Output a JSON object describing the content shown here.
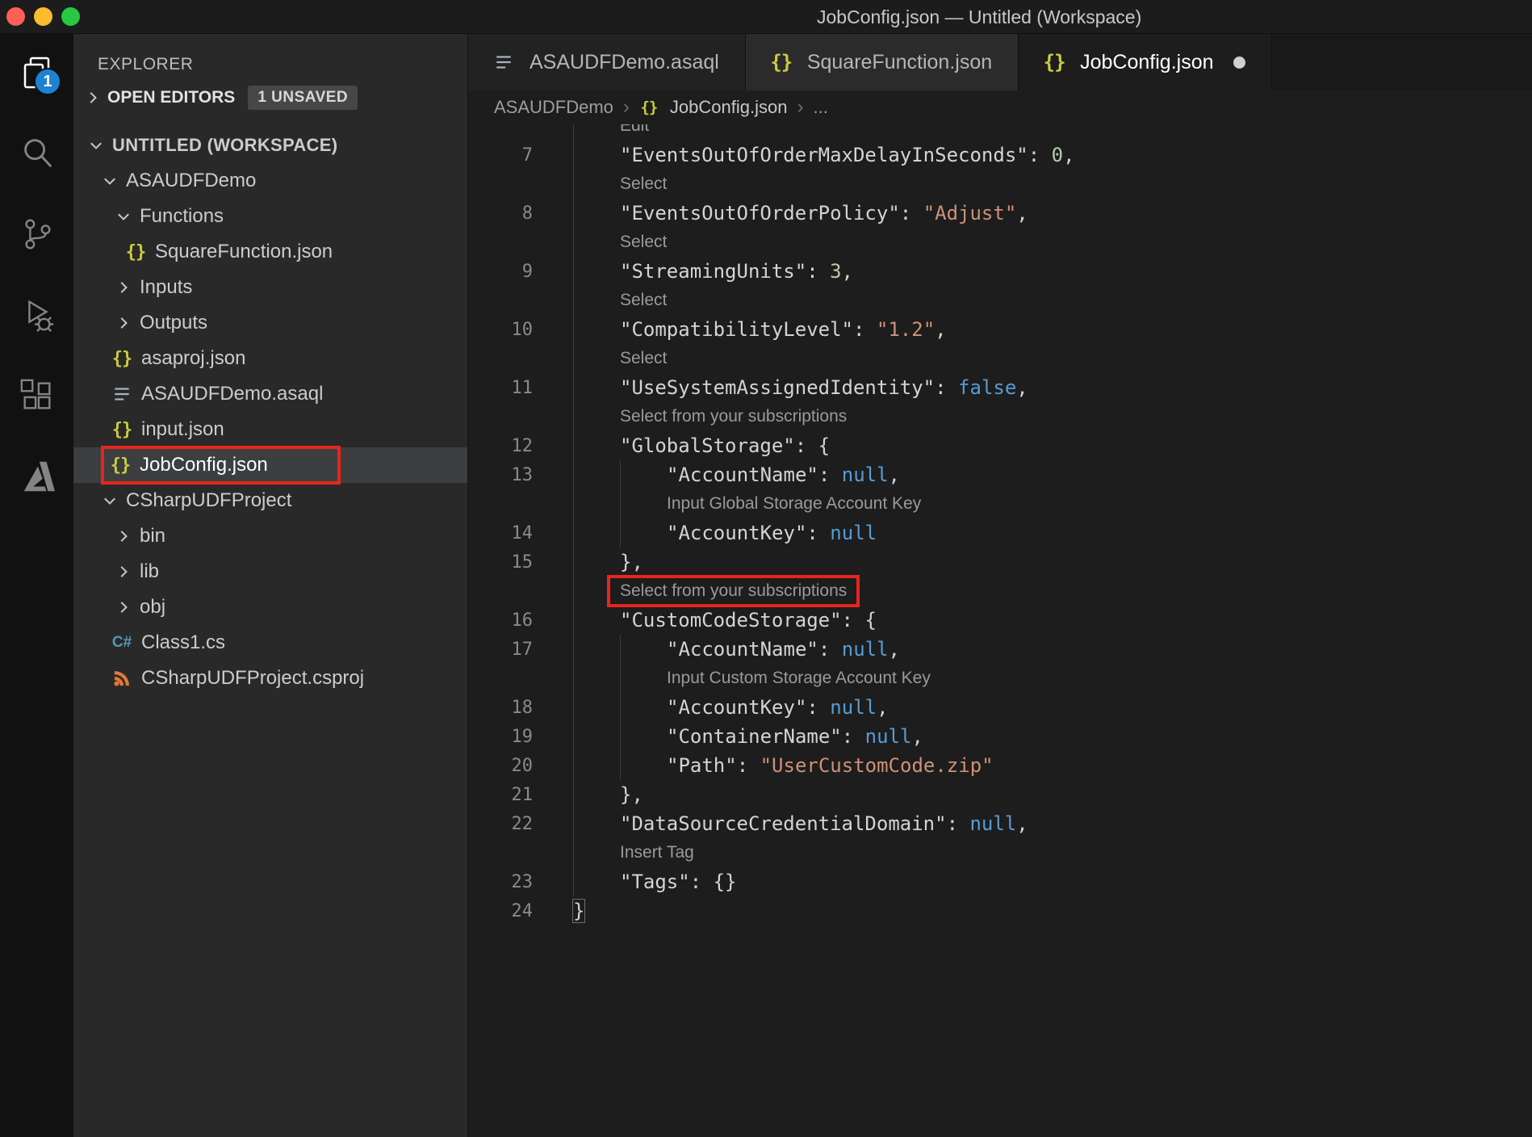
{
  "window": {
    "title": "JobConfig.json — Untitled (Workspace)"
  },
  "activity_bar": {
    "badge": "1",
    "items": [
      {
        "name": "explorer",
        "active": true
      },
      {
        "name": "search",
        "active": false
      },
      {
        "name": "source-control",
        "active": false
      },
      {
        "name": "run-debug",
        "active": false
      },
      {
        "name": "extensions",
        "active": false
      },
      {
        "name": "azure",
        "active": false
      }
    ]
  },
  "sidebar": {
    "header": "EXPLORER",
    "open_editors_label": "OPEN EDITORS",
    "unsaved_badge": "1 UNSAVED",
    "tree": [
      {
        "label": "UNTITLED (WORKSPACE)",
        "indent": 0,
        "root": true,
        "chevron": "expanded"
      },
      {
        "label": "ASAUDFDemo",
        "indent": 1,
        "chevron": "expanded"
      },
      {
        "label": "Functions",
        "indent": 2,
        "chevron": "expanded"
      },
      {
        "label": "SquareFunction.json",
        "indent": 3,
        "icon": "json"
      },
      {
        "label": "Inputs",
        "indent": 2,
        "chevron": "collapsed"
      },
      {
        "label": "Outputs",
        "indent": 2,
        "chevron": "collapsed"
      },
      {
        "label": "asaproj.json",
        "indent": 2,
        "icon": "json"
      },
      {
        "label": "ASAUDFDemo.asaql",
        "indent": 2,
        "icon": "asaql"
      },
      {
        "label": "input.json",
        "indent": 2,
        "icon": "json"
      },
      {
        "label": "JobConfig.json",
        "indent": 2,
        "icon": "json",
        "selected": true,
        "red_box": true
      },
      {
        "label": "CSharpUDFProject",
        "indent": 1,
        "chevron": "expanded"
      },
      {
        "label": "bin",
        "indent": 2,
        "chevron": "collapsed"
      },
      {
        "label": "lib",
        "indent": 2,
        "chevron": "collapsed"
      },
      {
        "label": "obj",
        "indent": 2,
        "chevron": "collapsed"
      },
      {
        "label": "Class1.cs",
        "indent": 2,
        "icon": "csharp"
      },
      {
        "label": "CSharpUDFProject.csproj",
        "indent": 2,
        "icon": "csproj"
      }
    ]
  },
  "tabs": [
    {
      "label": "ASAUDFDemo.asaql",
      "icon": "asaql",
      "active": false,
      "modified": false
    },
    {
      "label": "SquareFunction.json",
      "icon": "json",
      "active": false,
      "modified": false
    },
    {
      "label": "JobConfig.json",
      "icon": "json",
      "active": true,
      "modified": true
    }
  ],
  "breadcrumb": {
    "items": [
      {
        "label": "ASAUDFDemo"
      },
      {
        "label": "JobConfig.json",
        "icon": "json",
        "file": true
      },
      {
        "label": "..."
      }
    ]
  },
  "editor": {
    "rows": [
      {
        "kind": "lens",
        "indent": 1,
        "text": "Edit"
      },
      {
        "kind": "code",
        "ln": "7",
        "indent": 1,
        "tokens": [
          [
            "key",
            "\"EventsOutOfOrderMaxDelayInSeconds\""
          ],
          [
            "pun",
            ": "
          ],
          [
            "num",
            "0"
          ],
          [
            "pun",
            ","
          ]
        ]
      },
      {
        "kind": "lens",
        "indent": 1,
        "text": "Select"
      },
      {
        "kind": "code",
        "ln": "8",
        "indent": 1,
        "tokens": [
          [
            "key",
            "\"EventsOutOfOrderPolicy\""
          ],
          [
            "pun",
            ": "
          ],
          [
            "str",
            "\"Adjust\""
          ],
          [
            "pun",
            ","
          ]
        ]
      },
      {
        "kind": "lens",
        "indent": 1,
        "text": "Select"
      },
      {
        "kind": "code",
        "ln": "9",
        "indent": 1,
        "tokens": [
          [
            "key",
            "\"StreamingUnits\""
          ],
          [
            "pun",
            ": "
          ],
          [
            "num",
            "3"
          ],
          [
            "pun",
            ","
          ]
        ]
      },
      {
        "kind": "lens",
        "indent": 1,
        "text": "Select"
      },
      {
        "kind": "code",
        "ln": "10",
        "indent": 1,
        "tokens": [
          [
            "key",
            "\"CompatibilityLevel\""
          ],
          [
            "pun",
            ": "
          ],
          [
            "str",
            "\"1.2\""
          ],
          [
            "pun",
            ","
          ]
        ]
      },
      {
        "kind": "lens",
        "indent": 1,
        "text": "Select"
      },
      {
        "kind": "code",
        "ln": "11",
        "indent": 1,
        "tokens": [
          [
            "key",
            "\"UseSystemAssignedIdentity\""
          ],
          [
            "pun",
            ": "
          ],
          [
            "con",
            "false"
          ],
          [
            "pun",
            ","
          ]
        ]
      },
      {
        "kind": "lens",
        "indent": 1,
        "text": "Select from your subscriptions"
      },
      {
        "kind": "code",
        "ln": "12",
        "indent": 1,
        "tokens": [
          [
            "key",
            "\"GlobalStorage\""
          ],
          [
            "pun",
            ": {"
          ]
        ]
      },
      {
        "kind": "code",
        "ln": "13",
        "indent": 2,
        "tokens": [
          [
            "key",
            "\"AccountName\""
          ],
          [
            "pun",
            ": "
          ],
          [
            "con",
            "null"
          ],
          [
            "pun",
            ","
          ]
        ]
      },
      {
        "kind": "lens",
        "indent": 2,
        "text": "Input Global Storage Account Key"
      },
      {
        "kind": "code",
        "ln": "14",
        "indent": 2,
        "tokens": [
          [
            "key",
            "\"AccountKey\""
          ],
          [
            "pun",
            ": "
          ],
          [
            "con",
            "null"
          ]
        ]
      },
      {
        "kind": "code",
        "ln": "15",
        "indent": 1,
        "tokens": [
          [
            "pun",
            "},"
          ]
        ]
      },
      {
        "kind": "lens",
        "indent": 1,
        "text": "Select from your subscriptions",
        "box": true
      },
      {
        "kind": "code",
        "ln": "16",
        "indent": 1,
        "tokens": [
          [
            "key",
            "\"CustomCodeStorage\""
          ],
          [
            "pun",
            ": {"
          ]
        ]
      },
      {
        "kind": "code",
        "ln": "17",
        "indent": 2,
        "tokens": [
          [
            "key",
            "\"AccountName\""
          ],
          [
            "pun",
            ": "
          ],
          [
            "con",
            "null"
          ],
          [
            "pun",
            ","
          ]
        ]
      },
      {
        "kind": "lens",
        "indent": 2,
        "text": "Input Custom Storage Account Key"
      },
      {
        "kind": "code",
        "ln": "18",
        "indent": 2,
        "tokens": [
          [
            "key",
            "\"AccountKey\""
          ],
          [
            "pun",
            ": "
          ],
          [
            "con",
            "null"
          ],
          [
            "pun",
            ","
          ]
        ]
      },
      {
        "kind": "code",
        "ln": "19",
        "indent": 2,
        "tokens": [
          [
            "key",
            "\"ContainerName\""
          ],
          [
            "pun",
            ": "
          ],
          [
            "con",
            "null"
          ],
          [
            "pun",
            ","
          ]
        ]
      },
      {
        "kind": "code",
        "ln": "20",
        "indent": 2,
        "tokens": [
          [
            "key",
            "\"Path\""
          ],
          [
            "pun",
            ": "
          ],
          [
            "str",
            "\"UserCustomCode.zip\""
          ]
        ]
      },
      {
        "kind": "code",
        "ln": "21",
        "indent": 1,
        "tokens": [
          [
            "pun",
            "},"
          ]
        ]
      },
      {
        "kind": "code",
        "ln": "22",
        "indent": 1,
        "tokens": [
          [
            "key",
            "\"DataSourceCredentialDomain\""
          ],
          [
            "pun",
            ": "
          ],
          [
            "con",
            "null"
          ],
          [
            "pun",
            ","
          ]
        ]
      },
      {
        "kind": "lens",
        "indent": 1,
        "text": "Insert Tag"
      },
      {
        "kind": "code",
        "ln": "23",
        "indent": 1,
        "tokens": [
          [
            "key",
            "\"Tags\""
          ],
          [
            "pun",
            ": "
          ],
          [
            "pun",
            "{}"
          ]
        ]
      },
      {
        "kind": "code",
        "ln": "24",
        "indent": 0,
        "tokens": [
          [
            "brk",
            "}"
          ]
        ]
      }
    ]
  },
  "colors": {
    "key": "#d4d4d4",
    "pun": "#d4d4d4",
    "str": "#ce9178",
    "num": "#b5cea8",
    "con": "#569cd6",
    "brk": "#d4d4d4",
    "codelens": "#9a9a9a",
    "annotation_red": "#e8251d",
    "badge_blue": "#1d82d2",
    "json_icon_yellow": "#cbcb41",
    "csharp_icon_blue": "#519aba",
    "csproj_icon_orange": "#e37933"
  }
}
